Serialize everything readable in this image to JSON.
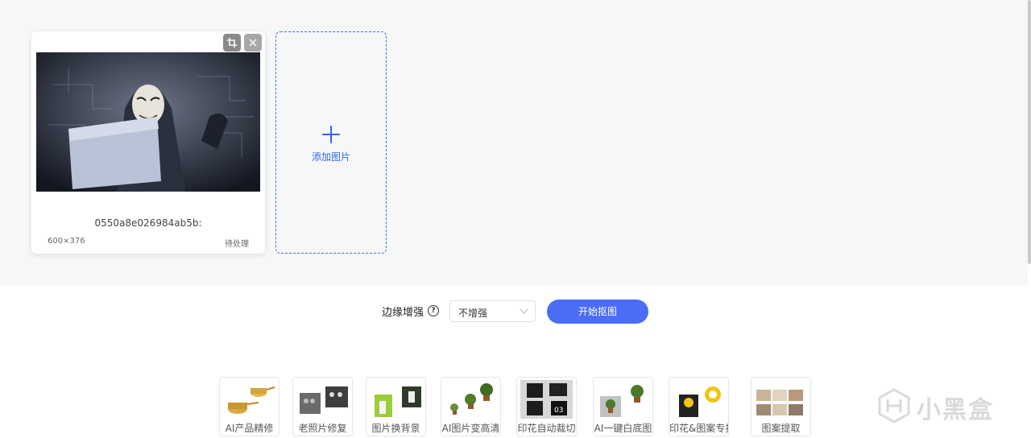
{
  "upload": {
    "card": {
      "filename": "0550a8e026984ab5b:",
      "dimensions": "600×376",
      "status": "待处理"
    },
    "add_label": "添加图片"
  },
  "controls": {
    "edge_label": "边缘增强",
    "edge_select_value": "不增强",
    "start_label": "开始抠图"
  },
  "tools": [
    {
      "label": "AI产品精修"
    },
    {
      "label": "老照片修复"
    },
    {
      "label": "图片换背景"
    },
    {
      "label": "AI图片变高清"
    },
    {
      "label": "印花自动裁切"
    },
    {
      "label": "AI一键白底图"
    },
    {
      "label": "印花&图案专抠"
    },
    {
      "label": "图案提取"
    }
  ],
  "watermark": {
    "text": "小黑盒"
  },
  "colors": {
    "accent": "#4a6cf7",
    "link": "#2f66e8",
    "panel_bg": "#f6f7f9"
  }
}
